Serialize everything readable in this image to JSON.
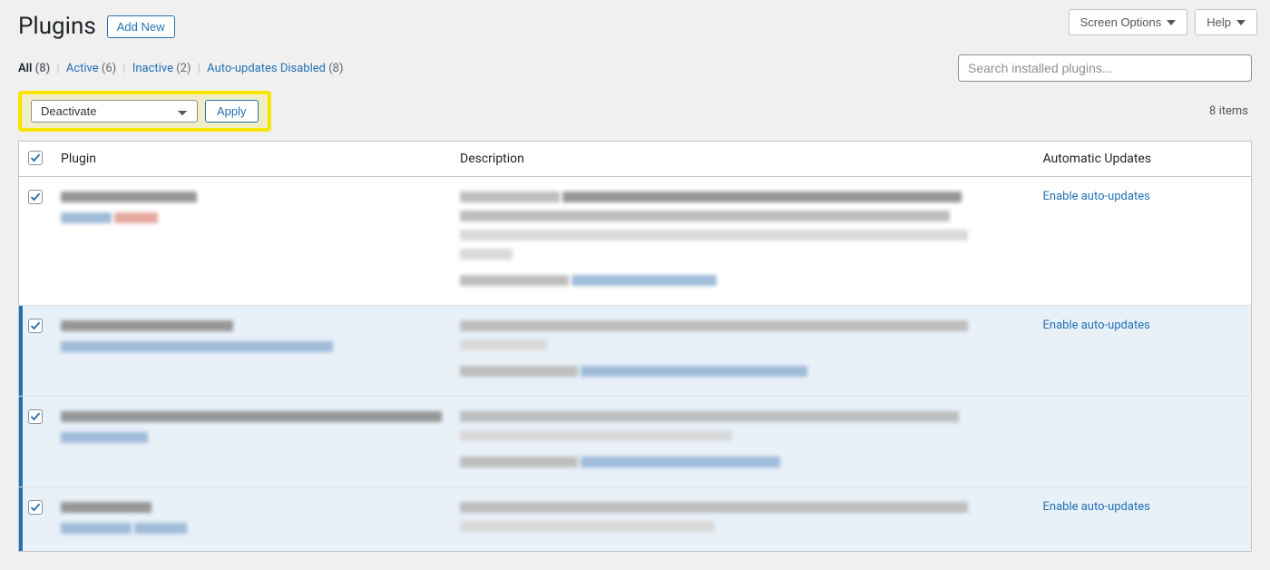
{
  "top_buttons": {
    "screen_options": "Screen Options",
    "help": "Help"
  },
  "header": {
    "title": "Plugins",
    "add_new": "Add New"
  },
  "filters": {
    "all": {
      "label": "All",
      "count": "(8)"
    },
    "active": {
      "label": "Active",
      "count": "(6)"
    },
    "inactive": {
      "label": "Inactive",
      "count": "(2)"
    },
    "auto_disabled": {
      "label": "Auto-updates Disabled",
      "count": "(8)"
    }
  },
  "search": {
    "placeholder": "Search installed plugins..."
  },
  "bulk": {
    "selected": "Deactivate",
    "apply": "Apply"
  },
  "items_count": "8 items",
  "columns": {
    "plugin": "Plugin",
    "description": "Description",
    "auto_updates": "Automatic Updates"
  },
  "auto_update_link": "Enable auto-updates"
}
